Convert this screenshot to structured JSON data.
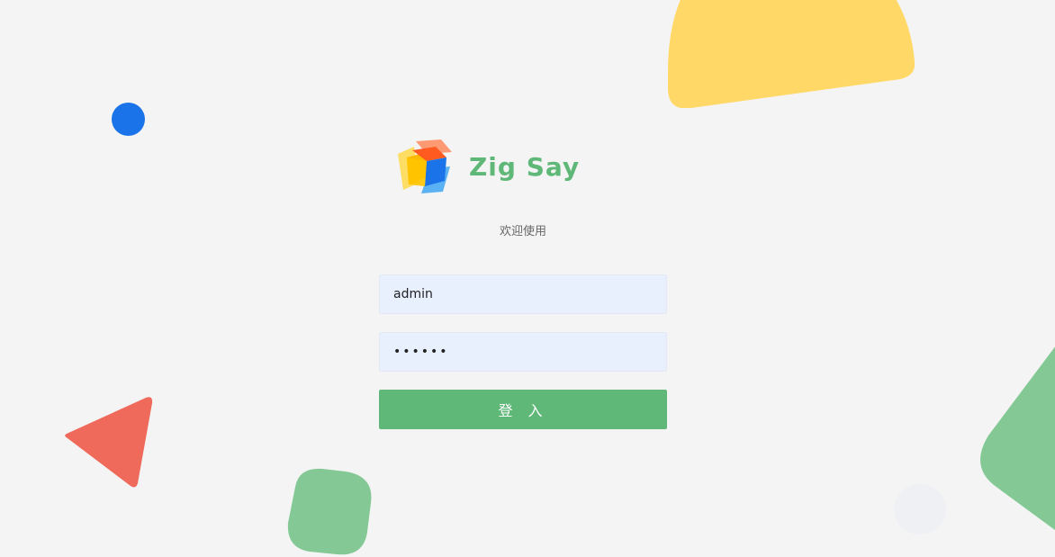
{
  "brand": {
    "name": "Zig Say",
    "subtitle": "欢迎使用",
    "logo_icon": "cube-logo-icon"
  },
  "form": {
    "username_value": "admin",
    "password_value": "123456",
    "login_label": "登 入"
  },
  "colors": {
    "background": "#f4f4f4",
    "accent_green": "#5fb878",
    "input_bg": "#e8f0fe",
    "yellow": "#ffd867",
    "blue": "#1a73e8",
    "red": "#ef6a5b",
    "light_green": "#84c995",
    "gray_dot": "#eef0f3"
  }
}
